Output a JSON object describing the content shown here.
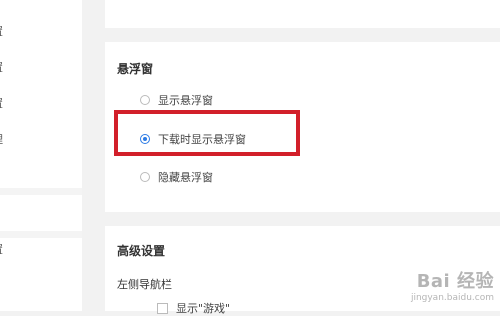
{
  "sidebar": {
    "items": [
      {
        "label": "置"
      },
      {
        "label": "置"
      },
      {
        "label": "置"
      },
      {
        "label": "理"
      },
      {
        "label": "置"
      }
    ]
  },
  "float_window": {
    "title": "悬浮窗",
    "options": [
      {
        "label": "显示悬浮窗",
        "checked": false
      },
      {
        "label": "下载时显示悬浮窗",
        "checked": true
      },
      {
        "label": "隐藏悬浮窗",
        "checked": false
      }
    ],
    "highlight_color": "#d21f2a"
  },
  "advanced": {
    "title": "高级设置",
    "left_nav_label": "左侧导航栏",
    "checkbox_label": "显示\"游戏\""
  },
  "colors": {
    "accent": "#2c7be5",
    "background": "#f2f2f2"
  },
  "watermark": {
    "main": "Bai 经验",
    "sub": "jingyan.baidu.com"
  }
}
